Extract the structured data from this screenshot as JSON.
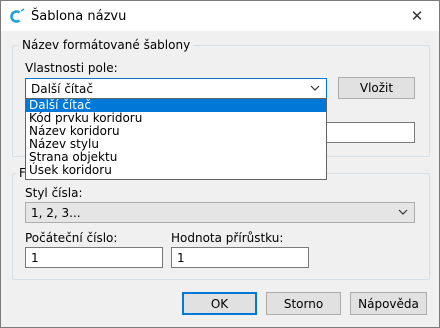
{
  "window": {
    "title": "Šablona názvu",
    "close_glyph": "✕"
  },
  "format_group": {
    "legend": "Název formátované šablony",
    "property_fields_label": "Vlastnosti pole:",
    "property_selected": "Další čítač",
    "insert_button": "Vložit",
    "dropdown_options": [
      "Další čítač",
      "Kód prvku koridoru",
      "Název koridoru",
      "Název stylu",
      "Strana objektu",
      "Úsek koridoru"
    ],
    "selected_index": 0
  },
  "numbering_group": {
    "legend_visible": "F",
    "number_style_label": "Styl čísla:",
    "number_style_value": "1, 2, 3...",
    "start_number_label": "Počáteční číslo:",
    "start_number_value": "1",
    "increment_label": "Hodnota přírůstku:",
    "increment_value": "1"
  },
  "footer": {
    "ok": "OK",
    "cancel": "Storno",
    "help": "Nápověda"
  },
  "colors": {
    "accent": "#0078d7",
    "window_bg": "#f0f0f0"
  }
}
